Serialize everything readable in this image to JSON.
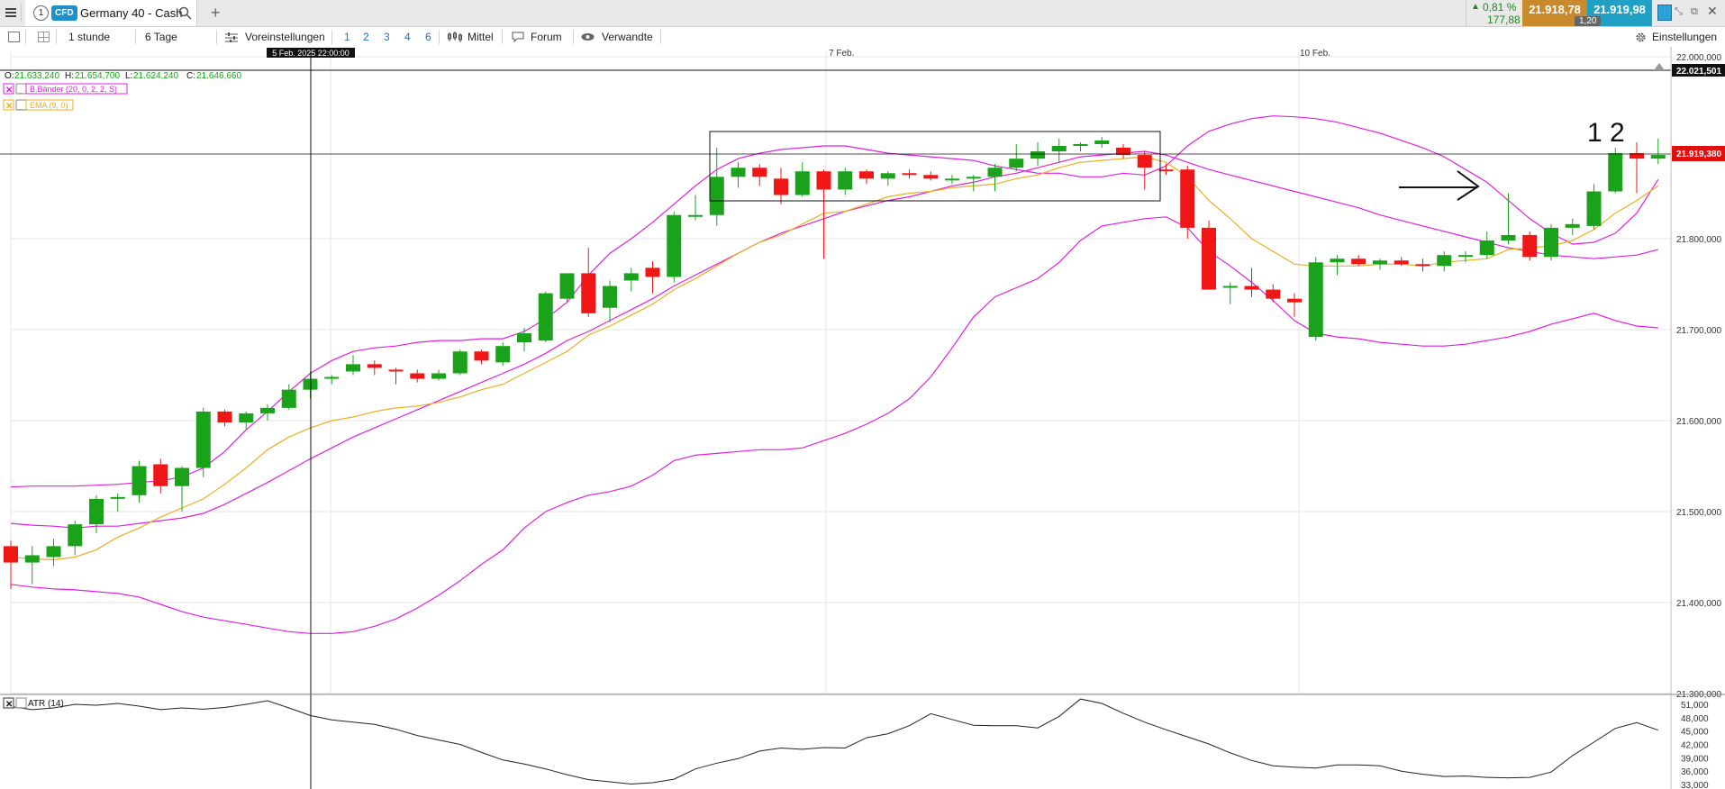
{
  "header": {
    "tab_number": "1",
    "badge": "CFD",
    "instrument": "Germany 40 - Cash",
    "add": "+",
    "change_pct": "0,81 %",
    "change_abs": "177,88",
    "bid": "21.918,78",
    "ask": "21.919,98",
    "spread": "1,20"
  },
  "toolbar": {
    "interval": "1 stunde",
    "range": "6 Tage",
    "presets": "Voreinstellungen",
    "layouts": [
      "1",
      "2",
      "3",
      "4",
      "6"
    ],
    "indicator": "Mittel",
    "forum": "Forum",
    "related": "Verwandte",
    "settings": "Einstellungen"
  },
  "chart": {
    "cursor_time": "5 Feb. 2025 22:00:00",
    "date_labels": [
      "7 Feb.",
      "10 Feb."
    ],
    "ohlc": {
      "o_label": "O:",
      "o": "21.633,240",
      "h_label": "H:",
      "h": "21.654,700",
      "l_label": "L:",
      "l": "21.624,240",
      "c_label": "C:",
      "c": "21.646,660"
    },
    "indicators": [
      "B.Bänder (20, 0, 2, 2, S)",
      "EMA (9, 0)"
    ],
    "atr_label": "ATR (14)",
    "last_price_tag": "21.919,380",
    "top_tag": "22.021,501",
    "annotation_text": "1 2",
    "colors": {
      "up": "#1aa31a",
      "down": "#f01616",
      "bollinger": "#e020e0",
      "ema": "#e8b020",
      "atr": "#222222"
    }
  },
  "chart_data": {
    "type": "candlestick",
    "series_names": [
      "B.Bänder (20, 0, 2, 2, S)",
      "EMA (9, 0)"
    ],
    "ylim": [
      21300,
      22021.5
    ],
    "y_ticks": [
      "21.300,000",
      "21.400,000",
      "21.500,000",
      "21.600,000",
      "21.700,000",
      "21.800,000",
      "22.000,000"
    ],
    "candles": [
      [
        21462,
        21468,
        21415,
        21444
      ],
      [
        21444,
        21462,
        21420,
        21452
      ],
      [
        21450,
        21470,
        21440,
        21462
      ],
      [
        21462,
        21490,
        21452,
        21486
      ],
      [
        21486,
        21518,
        21476,
        21514
      ],
      [
        21514,
        21520,
        21500,
        21516
      ],
      [
        21518,
        21556,
        21510,
        21550
      ],
      [
        21552,
        21558,
        21520,
        21528
      ],
      [
        21528,
        21550,
        21500,
        21548
      ],
      [
        21548,
        21614,
        21538,
        21610
      ],
      [
        21610,
        21612,
        21594,
        21598
      ],
      [
        21598,
        21610,
        21590,
        21608
      ],
      [
        21608,
        21618,
        21600,
        21614
      ],
      [
        21614,
        21640,
        21612,
        21634
      ],
      [
        21634,
        21654,
        21624,
        21646
      ],
      [
        21646,
        21650,
        21640,
        21648
      ],
      [
        21654,
        21672,
        21650,
        21662
      ],
      [
        21662,
        21666,
        21650,
        21658
      ],
      [
        21656,
        21658,
        21640,
        21654
      ],
      [
        21652,
        21656,
        21642,
        21646
      ],
      [
        21646,
        21656,
        21644,
        21652
      ],
      [
        21652,
        21678,
        21650,
        21676
      ],
      [
        21676,
        21678,
        21662,
        21666
      ],
      [
        21664,
        21686,
        21660,
        21682
      ],
      [
        21686,
        21702,
        21676,
        21696
      ],
      [
        21688,
        21742,
        21686,
        21740
      ],
      [
        21734,
        21762,
        21730,
        21762
      ],
      [
        21762,
        21790,
        21714,
        21718
      ],
      [
        21724,
        21754,
        21708,
        21748
      ],
      [
        21754,
        21768,
        21742,
        21762
      ],
      [
        21768,
        21775,
        21740,
        21758
      ],
      [
        21758,
        21830,
        21752,
        21826
      ],
      [
        21826,
        21848,
        21820,
        21826
      ],
      [
        21826,
        21900,
        21814,
        21868
      ],
      [
        21868,
        21884,
        21856,
        21878
      ],
      [
        21878,
        21882,
        21858,
        21868
      ],
      [
        21866,
        21878,
        21838,
        21848
      ],
      [
        21848,
        21884,
        21846,
        21874
      ],
      [
        21874,
        21876,
        21778,
        21854
      ],
      [
        21854,
        21878,
        21848,
        21874
      ],
      [
        21874,
        21876,
        21860,
        21866
      ],
      [
        21866,
        21874,
        21858,
        21872
      ],
      [
        21872,
        21876,
        21866,
        21870
      ],
      [
        21870,
        21874,
        21864,
        21866
      ],
      [
        21866,
        21870,
        21860,
        21866
      ],
      [
        21866,
        21870,
        21852,
        21868
      ],
      [
        21868,
        21882,
        21852,
        21878
      ],
      [
        21878,
        21904,
        21874,
        21888
      ],
      [
        21888,
        21906,
        21880,
        21896
      ],
      [
        21896,
        21910,
        21884,
        21902
      ],
      [
        21902,
        21906,
        21896,
        21904
      ],
      [
        21904,
        21912,
        21900,
        21908
      ],
      [
        21900,
        21904,
        21888,
        21892
      ],
      [
        21892,
        21896,
        21854,
        21878
      ],
      [
        21876,
        21882,
        21870,
        21874
      ],
      [
        21876,
        21880,
        21800,
        21812
      ],
      [
        21812,
        21820,
        21746,
        21744
      ],
      [
        21748,
        21752,
        21728,
        21748
      ],
      [
        21748,
        21768,
        21736,
        21744
      ],
      [
        21744,
        21750,
        21730,
        21734
      ],
      [
        21734,
        21740,
        21714,
        21730
      ],
      [
        21692,
        21780,
        21688,
        21774
      ],
      [
        21774,
        21782,
        21760,
        21778
      ],
      [
        21778,
        21782,
        21770,
        21772
      ],
      [
        21772,
        21778,
        21766,
        21776
      ],
      [
        21776,
        21780,
        21770,
        21772
      ],
      [
        21772,
        21778,
        21764,
        21770
      ],
      [
        21770,
        21786,
        21764,
        21782
      ],
      [
        21782,
        21786,
        21774,
        21782
      ],
      [
        21782,
        21808,
        21778,
        21798
      ],
      [
        21798,
        21850,
        21794,
        21804
      ],
      [
        21804,
        21808,
        21776,
        21780
      ],
      [
        21780,
        21816,
        21776,
        21812
      ],
      [
        21812,
        21822,
        21804,
        21816
      ],
      [
        21814,
        21860,
        21810,
        21852
      ],
      [
        21852,
        21900,
        21850,
        21894
      ],
      [
        21894,
        21906,
        21850,
        21888
      ],
      [
        21888,
        21910,
        21882,
        21892
      ]
    ],
    "bb_upper": [
      21527,
      21528,
      21528,
      21528,
      21529,
      21530,
      21532,
      21534,
      21538,
      21548,
      21566,
      21590,
      21610,
      21632,
      21652,
      21666,
      21676,
      21680,
      21682,
      21686,
      21688,
      21688,
      21690,
      21690,
      21698,
      21712,
      21730,
      21760,
      21784,
      21800,
      21818,
      21838,
      21858,
      21876,
      21888,
      21894,
      21898,
      21900,
      21902,
      21902,
      21898,
      21894,
      21892,
      21890,
      21888,
      21886,
      21880,
      21876,
      21872,
      21872,
      21868,
      21868,
      21872,
      21870,
      21880,
      21902,
      21918,
      21926,
      21932,
      21935,
      21934,
      21932,
      21928,
      21922,
      21916,
      21908,
      21900,
      21890,
      21876,
      21862,
      21842,
      21822,
      21806,
      21794,
      21796,
      21806,
      21828,
      21865
    ],
    "bb_middle": [
      21487,
      21485,
      21484,
      21482,
      21484,
      21484,
      21487,
      21490,
      21493,
      21498,
      21508,
      21520,
      21532,
      21545,
      21558,
      21570,
      21582,
      21592,
      21602,
      21612,
      21622,
      21632,
      21642,
      21652,
      21662,
      21674,
      21688,
      21698,
      21710,
      21722,
      21734,
      21748,
      21760,
      21772,
      21784,
      21796,
      21806,
      21814,
      21822,
      21830,
      21836,
      21842,
      21846,
      21852,
      21858,
      21862,
      21868,
      21872,
      21878,
      21884,
      21890,
      21892,
      21894,
      21896,
      21892,
      21884,
      21876,
      21870,
      21864,
      21858,
      21852,
      21846,
      21840,
      21834,
      21826,
      21820,
      21814,
      21808,
      21802,
      21796,
      21790,
      21786,
      21782,
      21780,
      21778,
      21780,
      21782,
      21788
    ],
    "bb_lower": [
      21420,
      21417,
      21415,
      21414,
      21412,
      21410,
      21406,
      21398,
      21390,
      21384,
      21380,
      21376,
      21372,
      21368,
      21366,
      21366,
      21368,
      21374,
      21382,
      21394,
      21408,
      21424,
      21442,
      21458,
      21482,
      21500,
      21510,
      21518,
      21522,
      21528,
      21540,
      21556,
      21562,
      21564,
      21566,
      21568,
      21568,
      21570,
      21578,
      21586,
      21596,
      21608,
      21624,
      21648,
      21680,
      21714,
      21736,
      21746,
      21756,
      21774,
      21798,
      21814,
      21818,
      21822,
      21824,
      21812,
      21786,
      21770,
      21752,
      21732,
      21710,
      21696,
      21692,
      21690,
      21686,
      21684,
      21682,
      21682,
      21684,
      21688,
      21692,
      21698,
      21706,
      21712,
      21718,
      21710,
      21704,
      21702
    ],
    "ema9": [
      21450,
      21448,
      21447,
      21450,
      21458,
      21472,
      21482,
      21494,
      21504,
      21514,
      21530,
      21548,
      21568,
      21582,
      21592,
      21600,
      21604,
      21610,
      21614,
      21616,
      21620,
      21626,
      21634,
      21640,
      21652,
      21664,
      21676,
      21694,
      21704,
      21716,
      21728,
      21744,
      21756,
      21770,
      21784,
      21796,
      21804,
      21816,
      21828,
      21830,
      21838,
      21846,
      21850,
      21852,
      21856,
      21858,
      21860,
      21866,
      21870,
      21878,
      21884,
      21886,
      21888,
      21890,
      21884,
      21868,
      21842,
      21822,
      21800,
      21786,
      21772,
      21770,
      21770,
      21770,
      21772,
      21772,
      21770,
      21774,
      21776,
      21778,
      21788,
      21790,
      21792,
      21798,
      21810,
      21828,
      21842,
      21858
    ],
    "atr": [
      50.5,
      49.8,
      50.2,
      51.0,
      50.8,
      51.2,
      50.6,
      49.8,
      50.2,
      49.9,
      50.3,
      51.0,
      51.8,
      50.2,
      48.5,
      47.5,
      47.0,
      46.5,
      45.4,
      44.0,
      43.0,
      42.0,
      40.2,
      38.5,
      37.6,
      36.5,
      35.2,
      34.1,
      33.6,
      33.1,
      33.4,
      34.2,
      36.5,
      37.8,
      38.8,
      40.5,
      41.2,
      40.9,
      41.3,
      41.2,
      43.5,
      44.4,
      46.2,
      48.9,
      47.6,
      46.3,
      46.2,
      46.2,
      45.7,
      48.3,
      52.2,
      51.2,
      49.0,
      47.0,
      45.3,
      43.7,
      42.1,
      40.1,
      38.4,
      37.2,
      36.9,
      36.7,
      37.4,
      37.4,
      37.2,
      36.0,
      35.3,
      34.8,
      34.9,
      34.6,
      34.5,
      34.6,
      35.8,
      39.5,
      42.5,
      45.6,
      46.9,
      45.2
    ],
    "atr_ticks": [
      "51,000",
      "48,000",
      "45,000",
      "42,000",
      "39,000",
      "36,000",
      "33,000"
    ]
  }
}
